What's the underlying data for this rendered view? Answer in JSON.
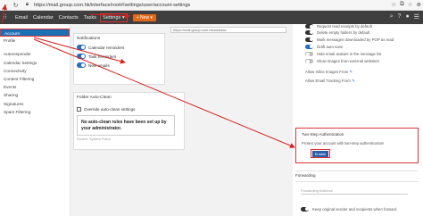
{
  "browser": {
    "url": "https://mail.group.com.hk/interface/root#/settings/user/account-settings"
  },
  "nav": {
    "items": [
      "Email",
      "Calendar",
      "Contacts",
      "Tasks"
    ],
    "settings_label": "Settings",
    "new_label": "New"
  },
  "sidebar": {
    "items": [
      "Account",
      "Profile",
      "Autoresponder",
      "Calendar Settings",
      "Connectivity",
      "Content Filtering",
      "Events",
      "Sharing",
      "Signatures",
      "Spam Filtering"
    ]
  },
  "middle": {
    "webdav_value": "https://mail.group.com.hk/webdav",
    "notifications_title": "Notifications",
    "notifications": [
      "Calendar reminders",
      "Task reminders",
      "New emails"
    ],
    "folder_auto_clean_title": "Folder Auto-Clean",
    "override_label": "Override auto-clean settings",
    "auto_clean_note": "No auto-clean rules have been set up by your administrator.",
    "source_label": "Source: System Policy"
  },
  "right": {
    "toggles": [
      {
        "label": "Request read receipts by default",
        "state": "on"
      },
      {
        "label": "Delete empty folders by default",
        "state": "on"
      },
      {
        "label": "Mark messages downloaded by POP as read",
        "state": "on"
      },
      {
        "label": "Draft auto-save",
        "state": "blue"
      },
      {
        "label": "Hide email avatars in the message list",
        "state": "off"
      },
      {
        "label": "Show images from external websites",
        "state": "off"
      }
    ],
    "allow_inline_label": "Allow Inline Images From",
    "allow_tracking_label": "Allow Email Tracking From",
    "tfa_title": "Two-Step Authentication",
    "tfa_desc": "Protect your account with two-step authentication!",
    "enable_label": "Enable",
    "forwarding_title": "Forwarding",
    "forwarding_address_label": "Forwarding Address",
    "keep_original_label": "Keep original sender and recipients when forward"
  }
}
